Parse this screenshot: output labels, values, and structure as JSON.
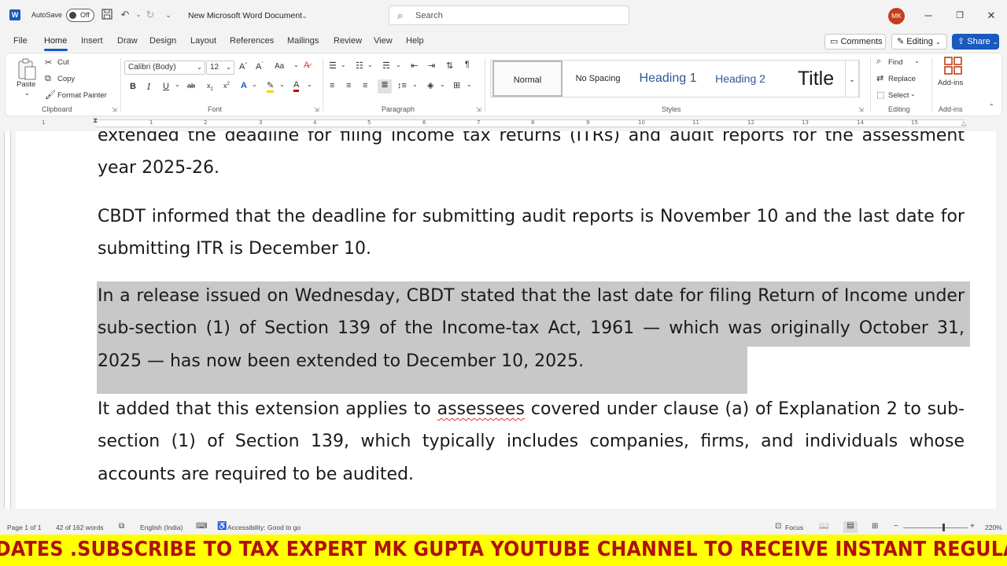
{
  "titlebar": {
    "autosave_label": "AutoSave",
    "autosave_state": "Off",
    "doc_title": "New Microsoft Word Document",
    "search_placeholder": "Search",
    "avatar_initials": "MK"
  },
  "tabs": [
    "File",
    "Home",
    "Insert",
    "Draw",
    "Design",
    "Layout",
    "References",
    "Mailings",
    "Review",
    "View",
    "Help"
  ],
  "active_tab": "Home",
  "header_buttons": {
    "comments": "Comments",
    "editing": "Editing",
    "share": "Share"
  },
  "ribbon": {
    "clipboard": {
      "paste": "Paste",
      "cut": "Cut",
      "copy": "Copy",
      "format_painter": "Format Painter",
      "label": "Clipboard"
    },
    "font": {
      "name": "Calibri (Body)",
      "size": "12",
      "label": "Font",
      "change_case": "Aa"
    },
    "paragraph": {
      "label": "Paragraph"
    },
    "styles": {
      "label": "Styles",
      "items": [
        "Normal",
        "No Spacing",
        "Heading 1",
        "Heading 2",
        "Title"
      ],
      "selected": "Normal"
    },
    "editing": {
      "find": "Find",
      "replace": "Replace",
      "select": "Select",
      "label": "Editing"
    },
    "addins": {
      "addins": "Add-ins",
      "label": "Add-ins"
    }
  },
  "ruler_numbers": [
    "1",
    "1",
    "2",
    "3",
    "4",
    "5",
    "6",
    "7",
    "8",
    "9",
    "10",
    "11",
    "12",
    "13",
    "14",
    "15"
  ],
  "document": {
    "paragraphs": [
      "extended the deadline for filing income tax returns (ITRs) and audit reports for the assessment year 2025-26.",
      "CBDT informed that the deadline for submitting audit reports is November 10 and the last date for submitting ITR is December 10.",
      "In a release issued on Wednesday, CBDT stated that the last date for filing Return of Income under sub-section (1) of Section 139 of the Income-tax Act, 1961 — which was originally October 31, 2025 — has now been extended to December 10, 2025.",
      {
        "before": "It added that this extension applies to ",
        "flagged_word": "assessees",
        "after": " covered under clause (a) of Explanation 2 to sub-section (1) of Section 139, which typically includes companies, firms, and individuals whose accounts are required to be audited."
      }
    ],
    "highlighted_paragraph_index": 2,
    "highlight_color": "#c8c8c8"
  },
  "statusbar": {
    "page": "Page 1 of 1",
    "words": "42 of 162 words",
    "language": "English (India)",
    "accessibility": "Accessibility: Good to go",
    "focus": "Focus",
    "zoom": "220%"
  },
  "banner": {
    "text": "DATES .SUBSCRIBE TO TAX EXPERT MK GUPTA YOUTUBE CHANNEL TO RECEIVE INSTANT REGULAR UPD",
    "background": "#ffff00",
    "color": "#b01010"
  },
  "colors": {
    "accent": "#185abd"
  }
}
